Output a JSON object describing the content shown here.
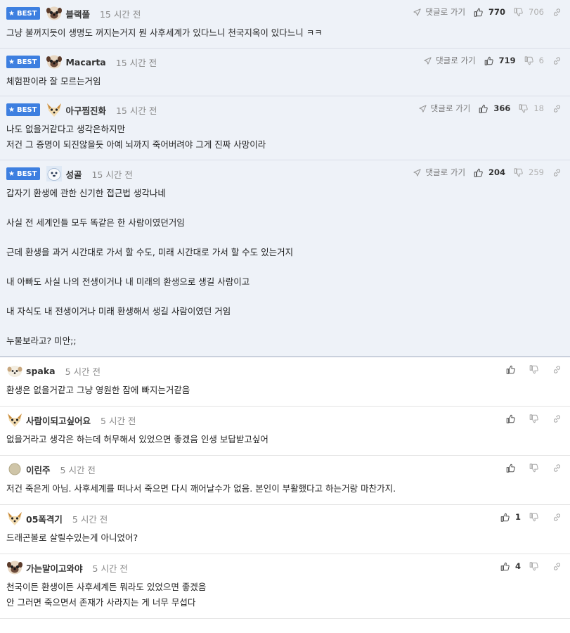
{
  "labels": {
    "best": "BEST",
    "reply": "댓글로 가기"
  },
  "best_comments": [
    {
      "nick": "블랙풀",
      "time": "15 시간 전",
      "avatar": "pug-avatar",
      "up": "770",
      "down": "706",
      "lines": [
        "그냥 불꺼지듯이 생명도 꺼지는거지 뭔 사후세계가 있다느니 천국지옥이 있다느니 ㅋㅋ"
      ]
    },
    {
      "nick": "Macarta",
      "time": "15 시간 전",
      "avatar": "pug-avatar",
      "up": "719",
      "down": "6",
      "lines": [
        "체험판이라 잘 모르는거임"
      ]
    },
    {
      "nick": "아구찜진화",
      "time": "15 시간 전",
      "avatar": "fox-avatar",
      "up": "366",
      "down": "18",
      "lines": [
        "나도 없을거같다고 생각은하지만",
        "저건 그 증명이 되진않을듯 아예 뇌까지 죽어버려야 그게 진짜 사망이라"
      ]
    },
    {
      "nick": "성골",
      "time": "15 시간 전",
      "avatar": "seal-avatar",
      "up": "204",
      "down": "259",
      "lines": [
        "갑자기 환생에 관한 신기한 접근법 생각나네",
        "",
        "사실 전 세계인들 모두 똑같은 한 사람이였던거임",
        "",
        "근데 환생을 과거 시간대로 가서 할 수도, 미래 시간대로 가서 할 수도 있는거지",
        "",
        "내 아빠도 사실 나의 전생이거나 내 미래의 환생으로 생길 사람이고",
        "",
        "내 자식도 내 전생이거나 미래 환생해서 생길 사람이였던 거임",
        "",
        "누물보라고? 미안;;"
      ]
    }
  ],
  "comments": [
    {
      "nick": "spaka",
      "time": "5 시간 전",
      "avatar": "puppy-avatar",
      "up": "",
      "lines": [
        "환생은 없을거같고 그냥 영원한 잠에 빠지는거같음"
      ]
    },
    {
      "nick": "사람이되고싶어요",
      "time": "5 시간 전",
      "avatar": "fox-avatar",
      "up": "",
      "lines": [
        "없을거라고 생각은 하는데 허무해서 있었으면 좋겠음 인생 보답받고싶어"
      ]
    },
    {
      "nick": "이린주",
      "time": "5 시간 전",
      "avatar": "circle-avatar",
      "up": "",
      "lines": [
        "저건 죽은게 아님. 사후세계를 떠나서 죽으면 다시 깨어날수가 없음. 본인이 부활했다고 하는거랑 마찬가지."
      ]
    },
    {
      "nick": "05폭격기",
      "time": "5 시간 전",
      "avatar": "fox-avatar",
      "up": "1",
      "lines": [
        "드래곤볼로 살릴수있는게 아니었어?"
      ]
    },
    {
      "nick": "가는말이고와야",
      "time": "5 시간 전",
      "avatar": "pug-avatar",
      "up": "4",
      "lines": [
        "천국이든 환생이든 사후세계든 뭐라도 있었으면 좋겠음",
        "안 그러면 죽으면서 존재가 사라지는 게 너무 무섭다"
      ]
    }
  ]
}
